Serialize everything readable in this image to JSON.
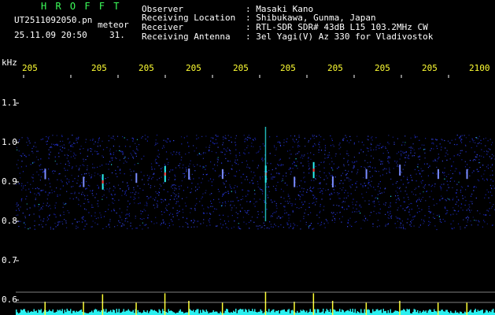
{
  "header": {
    "brand": "H R O F F T",
    "filename": "UT2511092050.pn",
    "detection_type": "meteor",
    "datetime": "25.11.09 20:50",
    "count": "31."
  },
  "metadata": [
    {
      "label": "Observer",
      "value": ": Masaki Kano"
    },
    {
      "label": "Receiving Location",
      "value": ": Shibukawa, Gunma, Japan"
    },
    {
      "label": "Receiver",
      "value": ": RTL-SDR SDR# 43dB L15 103.2MHz CW"
    },
    {
      "label": "Receiving Antenna",
      "value": ": 3el Yagi(V) Az 330 for Vladivostok"
    }
  ],
  "colors": {
    "background": "#000000",
    "header_text": "#3cff5a",
    "label_text": "#ffffff",
    "axis_time": "#ffff33",
    "signal_low": "#1d2cd8",
    "signal_mid": "#2af0f0",
    "signal_high": "#ff3a3a",
    "histogram": "#2af0f0",
    "histogram_peak": "#ffff33"
  },
  "chart_data": {
    "type": "heatmap",
    "ylabel": "kHz",
    "y_ticks": [
      "1.1",
      "1.0",
      "0.9",
      "0.8",
      "0.7",
      "0.6"
    ],
    "x_ticks": [
      "205",
      "205",
      "205",
      "205",
      "205",
      "205",
      "205",
      "205",
      "205",
      "2100"
    ],
    "noise_band_khz": [
      0.78,
      1.02
    ],
    "meteor_events": [
      {
        "x_frac": 0.06,
        "freq_khz": 0.92,
        "strength": 0.45
      },
      {
        "x_frac": 0.14,
        "freq_khz": 0.9,
        "strength": 0.45
      },
      {
        "x_frac": 0.18,
        "freq_khz": 0.9,
        "strength": 0.85
      },
      {
        "x_frac": 0.25,
        "freq_khz": 0.91,
        "strength": 0.4
      },
      {
        "x_frac": 0.31,
        "freq_khz": 0.92,
        "strength": 0.9
      },
      {
        "x_frac": 0.36,
        "freq_khz": 0.92,
        "strength": 0.5
      },
      {
        "x_frac": 0.43,
        "freq_khz": 0.92,
        "strength": 0.4
      },
      {
        "x_frac": 0.52,
        "freq_khz": 0.92,
        "strength": 0.98
      },
      {
        "x_frac": 0.58,
        "freq_khz": 0.9,
        "strength": 0.45
      },
      {
        "x_frac": 0.62,
        "freq_khz": 0.93,
        "strength": 0.9
      },
      {
        "x_frac": 0.66,
        "freq_khz": 0.9,
        "strength": 0.5
      },
      {
        "x_frac": 0.73,
        "freq_khz": 0.92,
        "strength": 0.4
      },
      {
        "x_frac": 0.8,
        "freq_khz": 0.93,
        "strength": 0.5
      },
      {
        "x_frac": 0.88,
        "freq_khz": 0.92,
        "strength": 0.4
      },
      {
        "x_frac": 0.94,
        "freq_khz": 0.92,
        "strength": 0.4
      }
    ]
  }
}
